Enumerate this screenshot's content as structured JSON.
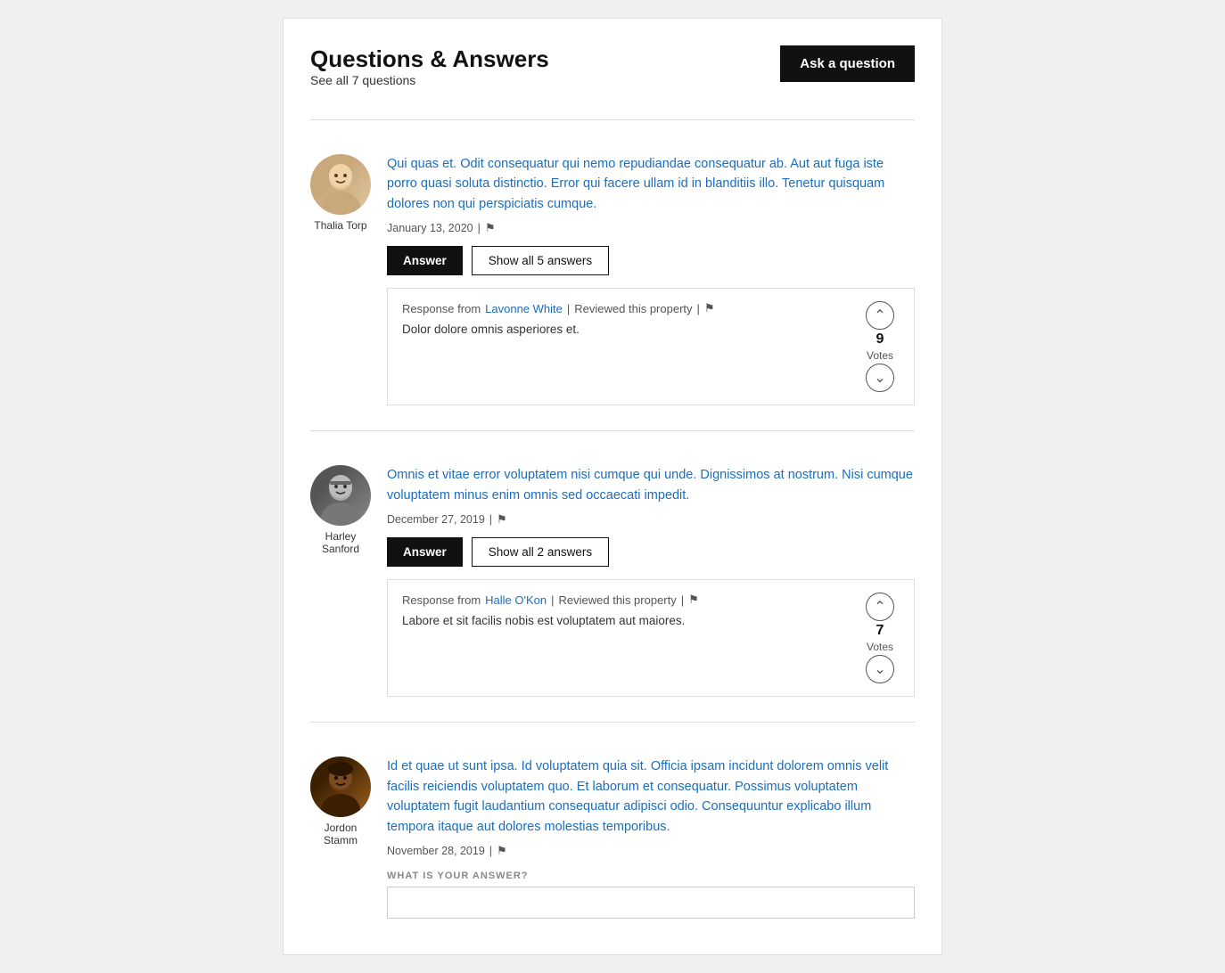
{
  "header": {
    "title": "Questions & Answers",
    "see_all": "See all 7 questions",
    "ask_button": "Ask a question"
  },
  "questions": [
    {
      "id": "q1",
      "author": "Thalia Torp",
      "avatar_color": "avatar-1",
      "text": "Qui quas et. Odit consequatur qui nemo repudiandae consequatur ab. Aut aut fuga iste porro quasi soluta distinctio. Error qui facere ullam id in blanditiis illo. Tenetur quisquam dolores non qui perspiciatis cumque.",
      "date": "January 13, 2020",
      "answer_btn": "Answer",
      "show_answers_btn": "Show all 5 answers",
      "answers": [
        {
          "from_label": "Response from",
          "from_name": "Lavonne White",
          "separator": "|",
          "reviewed": "Reviewed this property",
          "text": "Dolor dolore omnis asperiores et.",
          "vote_up": "▲",
          "vote_count": "9",
          "vote_label": "Votes",
          "vote_down": "▼"
        }
      ]
    },
    {
      "id": "q2",
      "author": "Harley Sanford",
      "avatar_color": "avatar-2",
      "text": "Omnis et vitae error voluptatem nisi cumque qui unde. Dignissimos at nostrum. Nisi cumque voluptatem minus enim omnis sed occaecati impedit.",
      "date": "December 27, 2019",
      "answer_btn": "Answer",
      "show_answers_btn": "Show all 2 answers",
      "answers": [
        {
          "from_label": "Response from",
          "from_name": "Halle O'Kon",
          "separator": "|",
          "reviewed": "Reviewed this property",
          "text": "Labore et sit facilis nobis est voluptatem aut maiores.",
          "vote_up": "▲",
          "vote_count": "7",
          "vote_label": "Votes",
          "vote_down": "▼"
        }
      ]
    },
    {
      "id": "q3",
      "author": "Jordon Stamm",
      "avatar_color": "avatar-3",
      "text": "Id et quae ut sunt ipsa. Id voluptatem quia sit. Officia ipsam incidunt dolorem omnis velit facilis reiciendis voluptatem quo. Et laborum et consequatur. Possimus voluptatem voluptatem fugit laudantium consequatur adipisci odio. Consequuntur explicabo illum tempora itaque aut dolores molestias temporibus.",
      "date": "November 28, 2019",
      "answer_btn": null,
      "show_answers_btn": null,
      "answers": [],
      "what_is_answer_label": "WHAT IS YOUR ANSWER?"
    }
  ]
}
